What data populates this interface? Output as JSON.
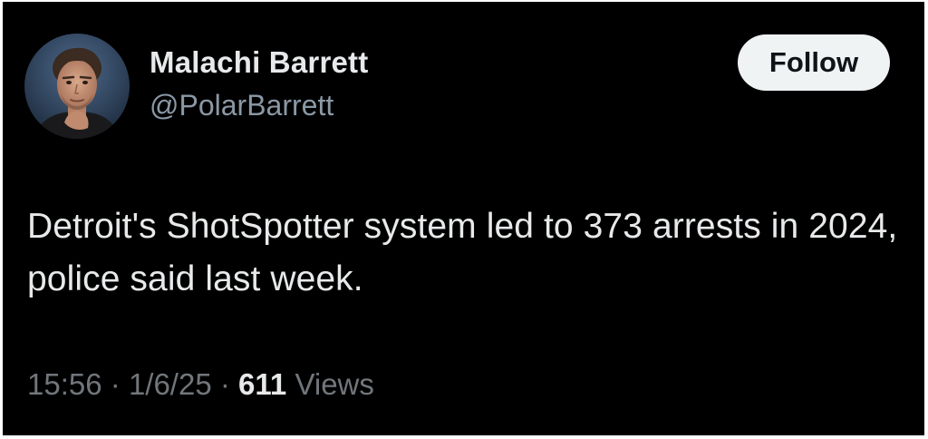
{
  "author": {
    "display_name": "Malachi Barrett",
    "handle": "@PolarBarrett",
    "avatar_icon": "profile-photo"
  },
  "follow_button": {
    "label": "Follow"
  },
  "tweet": {
    "text": "Detroit's ShotSpotter system led to 373 arrests in 2024, police said last week.",
    "time": "15:56",
    "date": "1/6/25",
    "separator": "·",
    "views_count": "611",
    "views_label": "Views"
  },
  "colors": {
    "background": "#000000",
    "primary_text": "#e7e9ea",
    "secondary_text": "#71767b",
    "button_bg": "#eff3f4",
    "button_text": "#0f1419"
  }
}
